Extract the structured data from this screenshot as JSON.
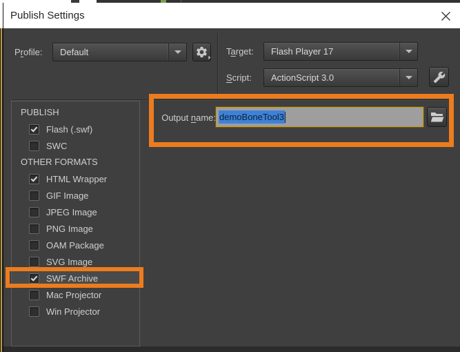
{
  "dialog": {
    "title": "Publish Settings"
  },
  "profile": {
    "label": {
      "pre": "P",
      "mnemonic": "r",
      "post": "ofile:"
    },
    "value": "Default"
  },
  "target": {
    "label": {
      "pre": "T",
      "mnemonic": "a",
      "post": "rget:"
    },
    "value": "Flash Player 17"
  },
  "script": {
    "label": {
      "pre": "",
      "mnemonic": "S",
      "post": "cript:"
    },
    "value": "ActionScript 3.0"
  },
  "output": {
    "label": {
      "pre": "Output ",
      "mnemonic": "n",
      "post": "ame:"
    },
    "value": "demoBoneTool3"
  },
  "formats": {
    "sections": [
      {
        "heading": "PUBLISH",
        "items": [
          {
            "label": "Flash (.swf)",
            "checked": true,
            "highlighted": false
          },
          {
            "label": "SWC",
            "checked": false,
            "highlighted": false
          }
        ]
      },
      {
        "heading": "OTHER FORMATS",
        "items": [
          {
            "label": "HTML Wrapper",
            "checked": true,
            "highlighted": false
          },
          {
            "label": "GIF Image",
            "checked": false,
            "highlighted": false
          },
          {
            "label": "JPEG Image",
            "checked": false,
            "highlighted": false
          },
          {
            "label": "PNG Image",
            "checked": false,
            "highlighted": false
          },
          {
            "label": "OAM Package",
            "checked": false,
            "highlighted": false
          },
          {
            "label": "SVG Image",
            "checked": false,
            "highlighted": false
          },
          {
            "label": "SWF Archive",
            "checked": true,
            "highlighted": true
          },
          {
            "label": "Mac Projector",
            "checked": false,
            "highlighted": false
          },
          {
            "label": "Win Projector",
            "checked": false,
            "highlighted": false
          }
        ]
      }
    ]
  },
  "icons": {
    "close": "x-icon",
    "profile_options": "gear-icon",
    "script_settings": "wrench-icon",
    "browse_output": "folder-open-icon",
    "dropdown": "chevron-down-icon"
  },
  "colors": {
    "annotation_orange": "#EC7C1E",
    "selection_blue": "#3E82D8",
    "focus_ring_yellow": "#C49B26",
    "dialog_background": "#3F3F3F"
  }
}
